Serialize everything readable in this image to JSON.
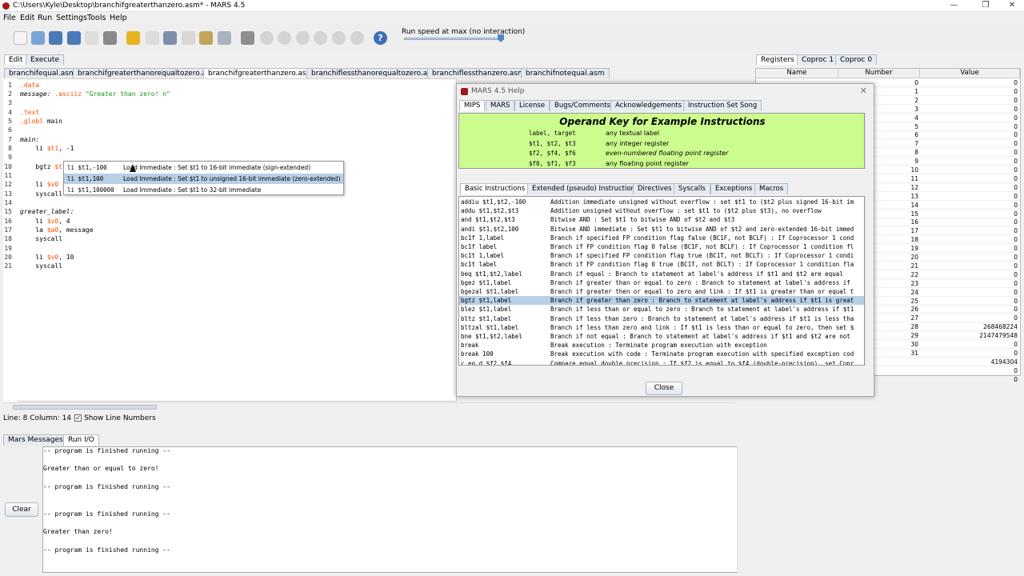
{
  "window": {
    "title": "C:\\Users\\Kyle\\Desktop\\branchifgreaterthanzero.asm* - MARS 4.5",
    "minimize": "—",
    "maximize": "❐",
    "close": "✕"
  },
  "menu": [
    "File",
    "Edit",
    "Run",
    "Settings",
    "Tools",
    "Help"
  ],
  "toolbar": {
    "speed_label": "Run speed at max (no interaction)",
    "speed": 1.0
  },
  "main_tabs": [
    "Edit",
    "Execute"
  ],
  "file_tabs": [
    "branchifequal.asm",
    "branchifgreaterthanorequaltozero.asm",
    "branchifgreaterthanzero.asm*",
    "branchiflessthanorequaltozero.asm",
    "branchiflessthanzero.asm",
    "branchifnotequal.asm"
  ],
  "code": {
    "lines": [
      "1",
      "2",
      "3",
      "4",
      "5",
      "6",
      "7",
      "8",
      "9",
      "10",
      "11",
      "12",
      "13",
      "14",
      "15",
      "16",
      "17",
      "18",
      "19",
      "20",
      "21"
    ],
    "l1": ".data",
    "l2a": "message:",
    "l2b": " .asciiz ",
    "l2c": "\"Greater than zero! n\"",
    "l4": ".text",
    "l5a": ".globl",
    "l5b": " main",
    "l7": "main:",
    "l8a": "    li ",
    "l8b": "$t1",
    "l8c": ", -1",
    "l10a": "    bgtz ",
    "l10b": "$t1",
    "l12a": "    li ",
    "l12b": "$v0",
    "l13": "    syscall",
    "l15": "greater_label:",
    "l16a": "    li ",
    "l16b": "$v0",
    "l16c": ", 4",
    "l17a": "    la ",
    "l17b": "$a0",
    "l17c": ", message",
    "l18": "    syscall",
    "l20a": "    li ",
    "l20b": "$v0",
    "l20c": ", 10",
    "l21": "    syscall"
  },
  "autocomplete": [
    {
      "code": "li $t1,-100",
      "desc": "Load Immediate : Set $t1 to 16-bit immediate (sign-extended)"
    },
    {
      "code": "li $t1,100",
      "desc": "Load Immediate : Set $t1 to unsigned 16-bit immediate (zero-extended)"
    },
    {
      "code": "li $t1,100000",
      "desc": "Load Immediate : Set $t1 to 32-bit immediate"
    }
  ],
  "status": {
    "position": "Line: 8 Column: 14",
    "show_line_numbers": "Show Line Numbers",
    "check": "✓"
  },
  "bottom_tabs": [
    "Mars Messages",
    "Run I/O"
  ],
  "messages": [
    "-- program is finished running --",
    "Greater than or equal to zero!",
    "-- program is finished running --",
    "-- program is finished running --",
    "Greater than zero!",
    "-- program is finished running --"
  ],
  "clear_label": "Clear",
  "register_tabs": [
    "Registers",
    "Coproc 1",
    "Coproc 0"
  ],
  "register_headers": [
    "Name",
    "Number",
    "Value"
  ],
  "registers": [
    {
      "num": "0",
      "val": "0"
    },
    {
      "num": "1",
      "val": "0"
    },
    {
      "num": "2",
      "val": "0"
    },
    {
      "num": "3",
      "val": "0"
    },
    {
      "num": "4",
      "val": "0"
    },
    {
      "num": "5",
      "val": "0"
    },
    {
      "num": "6",
      "val": "0"
    },
    {
      "num": "7",
      "val": "0"
    },
    {
      "num": "8",
      "val": "0"
    },
    {
      "num": "9",
      "val": "0"
    },
    {
      "num": "10",
      "val": "0"
    },
    {
      "num": "11",
      "val": "0"
    },
    {
      "num": "12",
      "val": "0"
    },
    {
      "num": "13",
      "val": "0"
    },
    {
      "num": "14",
      "val": "0"
    },
    {
      "num": "15",
      "val": "0"
    },
    {
      "num": "16",
      "val": "0"
    },
    {
      "num": "17",
      "val": "0"
    },
    {
      "num": "18",
      "val": "0"
    },
    {
      "num": "19",
      "val": "0"
    },
    {
      "num": "20",
      "val": "0"
    },
    {
      "num": "21",
      "val": "0"
    },
    {
      "num": "22",
      "val": "0"
    },
    {
      "num": "23",
      "val": "0"
    },
    {
      "num": "24",
      "val": "0"
    },
    {
      "num": "25",
      "val": "0"
    },
    {
      "num": "26",
      "val": "0"
    },
    {
      "num": "27",
      "val": "0"
    },
    {
      "num": "28",
      "val": "268468224"
    },
    {
      "num": "29",
      "val": "2147479548"
    },
    {
      "num": "30",
      "val": "0"
    },
    {
      "num": "31",
      "val": "0"
    },
    {
      "num": "",
      "val": "4194304"
    },
    {
      "num": "",
      "val": "0"
    },
    {
      "num": "",
      "val": "0"
    }
  ],
  "help": {
    "title": "MARS 4.5 Help",
    "close": "✕",
    "tabs": [
      "MIPS",
      "MARS",
      "License",
      "Bugs/Comments",
      "Acknowledgements",
      "Instruction Set Song"
    ],
    "opkey_title": "Operand Key for Example Instructions",
    "opkey": [
      {
        "ops": "label, target",
        "desc": "any textual label"
      },
      {
        "ops": "$t1, $t2, $t3",
        "desc": "any integer register"
      },
      {
        "ops": "$f2, $f4, $f6",
        "desc": "even-numbered floating point register"
      },
      {
        "ops": "$f0, $f1, $f3",
        "desc": "any floating point register"
      }
    ],
    "inst_tabs": [
      "Basic Instructions",
      "Extended (pseudo) Instructions",
      "Directives",
      "Syscalls",
      "Exceptions",
      "Macros"
    ],
    "instructions": [
      {
        "i": "addiu $t1,$t2,-100",
        "d": "Addition immediate unsigned without overflow : set $t1 to ($t2 plus signed 16-bit im"
      },
      {
        "i": "addu $t1,$t2,$t3",
        "d": "Addition unsigned without overflow : set $t1 to ($t2 plus $t3), no overflow"
      },
      {
        "i": "and $t1,$t2,$t3",
        "d": "Bitwise AND : Set $t1 to bitwise AND of $t2 and $t3"
      },
      {
        "i": "andi $t1,$t2,100",
        "d": "Bitwise AND immediate : Set $t1 to bitwise AND of $t2 and zero-extended 16-bit immed"
      },
      {
        "i": "bc1f 1,label",
        "d": "Branch if specified FP condition flag false (BC1F, not BCLF) : If Coprocessor 1 cond"
      },
      {
        "i": "bc1f label",
        "d": "Branch if FP condition flag 0 false (BC1F, not BCLF) : If Coprocessor 1 condition fl"
      },
      {
        "i": "bc1t 1,label",
        "d": "Branch if specified FP condition flag true (BC1T, not BCLT) : If Coprocessor 1 condi"
      },
      {
        "i": "bc1t label",
        "d": "Branch if FP condition flag 0 true (BC1T, not BCLT) : If Coprocessor 1 condition fla"
      },
      {
        "i": "beq $t1,$t2,label",
        "d": "Branch if equal : Branch to statement at label's address if $t1 and $t2 are equal"
      },
      {
        "i": "bgez $t1,label",
        "d": "Branch if greater than or equal to zero : Branch to statement at label's address if"
      },
      {
        "i": "bgezal $t1,label",
        "d": "Branch if greater then or equal to zero and link : If $t1 is greater than or equal t"
      },
      {
        "i": "bgtz $t1,label",
        "d": "Branch if greater than zero : Branch to statement at label's address if $t1 is great"
      },
      {
        "i": "blez $t1,label",
        "d": "Branch if less than or equal to zero : Branch to statement at label's address if $t1"
      },
      {
        "i": "bltz $t1,label",
        "d": "Branch if less than zero : Branch to statement at label's address if $t1 is less tha"
      },
      {
        "i": "bltzal $t1,label",
        "d": "Branch if less than zero and link : If $t1 is less than or equal to zero, then set $"
      },
      {
        "i": "bne $t1,$t2,label",
        "d": "Branch if not equal : Branch to statement at label's address if $t1 and $t2 are not"
      },
      {
        "i": "break",
        "d": "Break execution : Terminate program execution with exception"
      },
      {
        "i": "break 100",
        "d": "Break execution with code : Terminate program execution with specified exception cod"
      },
      {
        "i": "c.eq.d $f2,$f4",
        "d": "Compare equal double precision : If $f2 is equal to $f4 (double-precision), set Copr"
      }
    ],
    "close_label": "Close"
  },
  "colors": {
    "opkey_bg": "#cdfc8e",
    "selection": "#b8cfe5",
    "directive": "#ff4c00",
    "string": "#1b8f1b"
  }
}
